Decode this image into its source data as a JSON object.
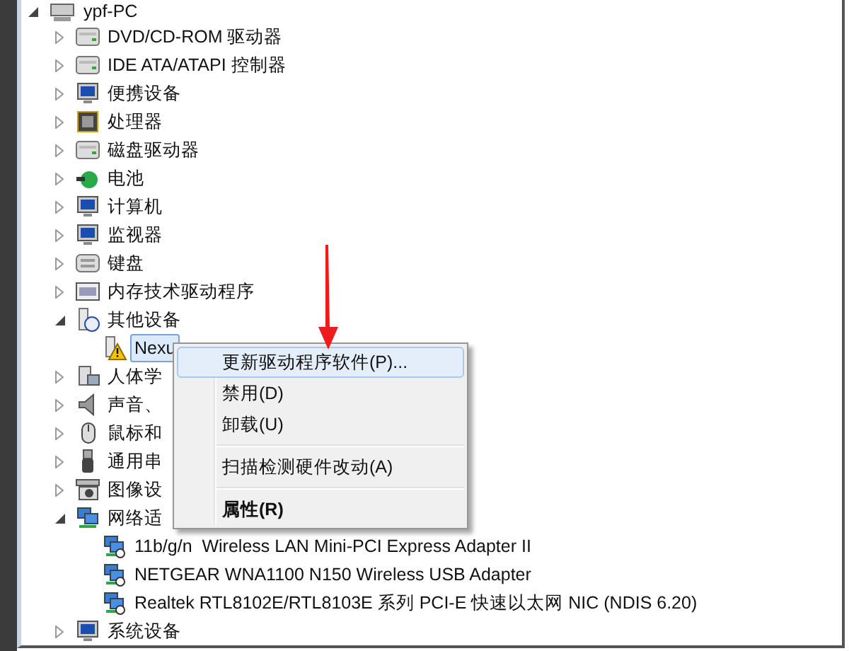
{
  "tree": {
    "label": "ypf-PC",
    "expanded": true,
    "selected": false,
    "children": [
      {
        "label": "DVD/CD-ROM 驱动器",
        "expanded": false,
        "selected": false
      },
      {
        "label": "IDE ATA/ATAPI 控制器",
        "expanded": false,
        "selected": false
      },
      {
        "label": "便携设备",
        "expanded": false,
        "selected": false
      },
      {
        "label": "处理器",
        "expanded": false,
        "selected": false
      },
      {
        "label": "磁盘驱动器",
        "expanded": false,
        "selected": false
      },
      {
        "label": "电池",
        "expanded": false,
        "selected": false
      },
      {
        "label": "计算机",
        "expanded": false,
        "selected": false
      },
      {
        "label": "监视器",
        "expanded": false,
        "selected": false
      },
      {
        "label": "键盘",
        "expanded": false,
        "selected": false
      },
      {
        "label": "内存技术驱动程序",
        "expanded": false,
        "selected": false
      },
      {
        "label": "其他设备",
        "expanded": true,
        "selected": false,
        "children": [
          {
            "label": "Nexu",
            "selected": true,
            "warning": true
          }
        ]
      },
      {
        "label": "人体学",
        "expanded": false,
        "selected": false
      },
      {
        "label": "声音、",
        "expanded": false,
        "selected": false
      },
      {
        "label": "鼠标和",
        "expanded": false,
        "selected": false
      },
      {
        "label": "通用串",
        "expanded": false,
        "selected": false
      },
      {
        "label": "图像设",
        "expanded": false,
        "selected": false
      },
      {
        "label": "网络适",
        "expanded": true,
        "selected": false,
        "children": [
          {
            "label": "11b/g/n  Wireless LAN Mini-PCI Express Adapter II",
            "selected": false,
            "warning": false
          },
          {
            "label": "NETGEAR WNA1100 N150 Wireless USB Adapter",
            "selected": false,
            "warning": false
          },
          {
            "label": "Realtek RTL8102E/RTL8103E 系列 PCI-E 快速以太网 NIC (NDIS 6.20)",
            "selected": false,
            "warning": false
          }
        ]
      },
      {
        "label": "系统设备",
        "expanded": false,
        "selected": false
      }
    ]
  },
  "context_menu": [
    {
      "kind": "item",
      "label": "更新驱动程序软件(P)...",
      "selected": true,
      "default": false
    },
    {
      "kind": "item",
      "label": "禁用(D)",
      "selected": false,
      "default": false
    },
    {
      "kind": "item",
      "label": "卸载(U)",
      "selected": false,
      "default": false
    },
    {
      "kind": "separator"
    },
    {
      "kind": "item",
      "label": "扫描检测硬件改动(A)",
      "selected": false,
      "default": false
    },
    {
      "kind": "separator"
    },
    {
      "kind": "item",
      "label": "属性(R)",
      "selected": false,
      "default": true
    }
  ]
}
